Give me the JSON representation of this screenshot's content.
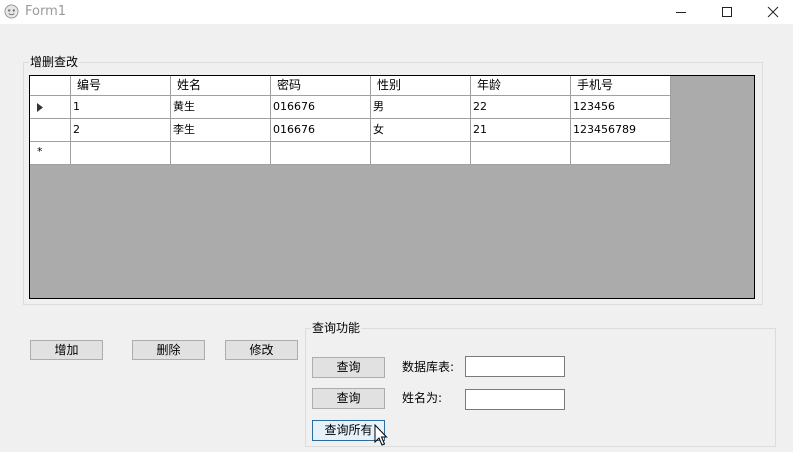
{
  "window": {
    "title": "Form1"
  },
  "crud_group": {
    "legend": "增删查改"
  },
  "grid": {
    "columns": [
      "编号",
      "姓名",
      "密码",
      "性别",
      "年龄",
      "手机号"
    ],
    "rows": [
      [
        "1",
        "黄生",
        "016676",
        "男",
        "22",
        "123456"
      ],
      [
        "2",
        "李生",
        "016676",
        "女",
        "21",
        "123456789"
      ]
    ],
    "new_row_marker": "*"
  },
  "actions": {
    "add_label": "增加",
    "delete_label": "删除",
    "modify_label": "修改"
  },
  "query_group": {
    "legend": "查询功能",
    "query_button_1": "查询",
    "table_label": "数据库表:",
    "table_value": "",
    "query_button_2": "查询",
    "name_label": "姓名为:",
    "name_value": "",
    "query_all_label": "查询所有"
  },
  "colors": {
    "grid_background": "#ababab",
    "focus_border": "#0078d7"
  }
}
